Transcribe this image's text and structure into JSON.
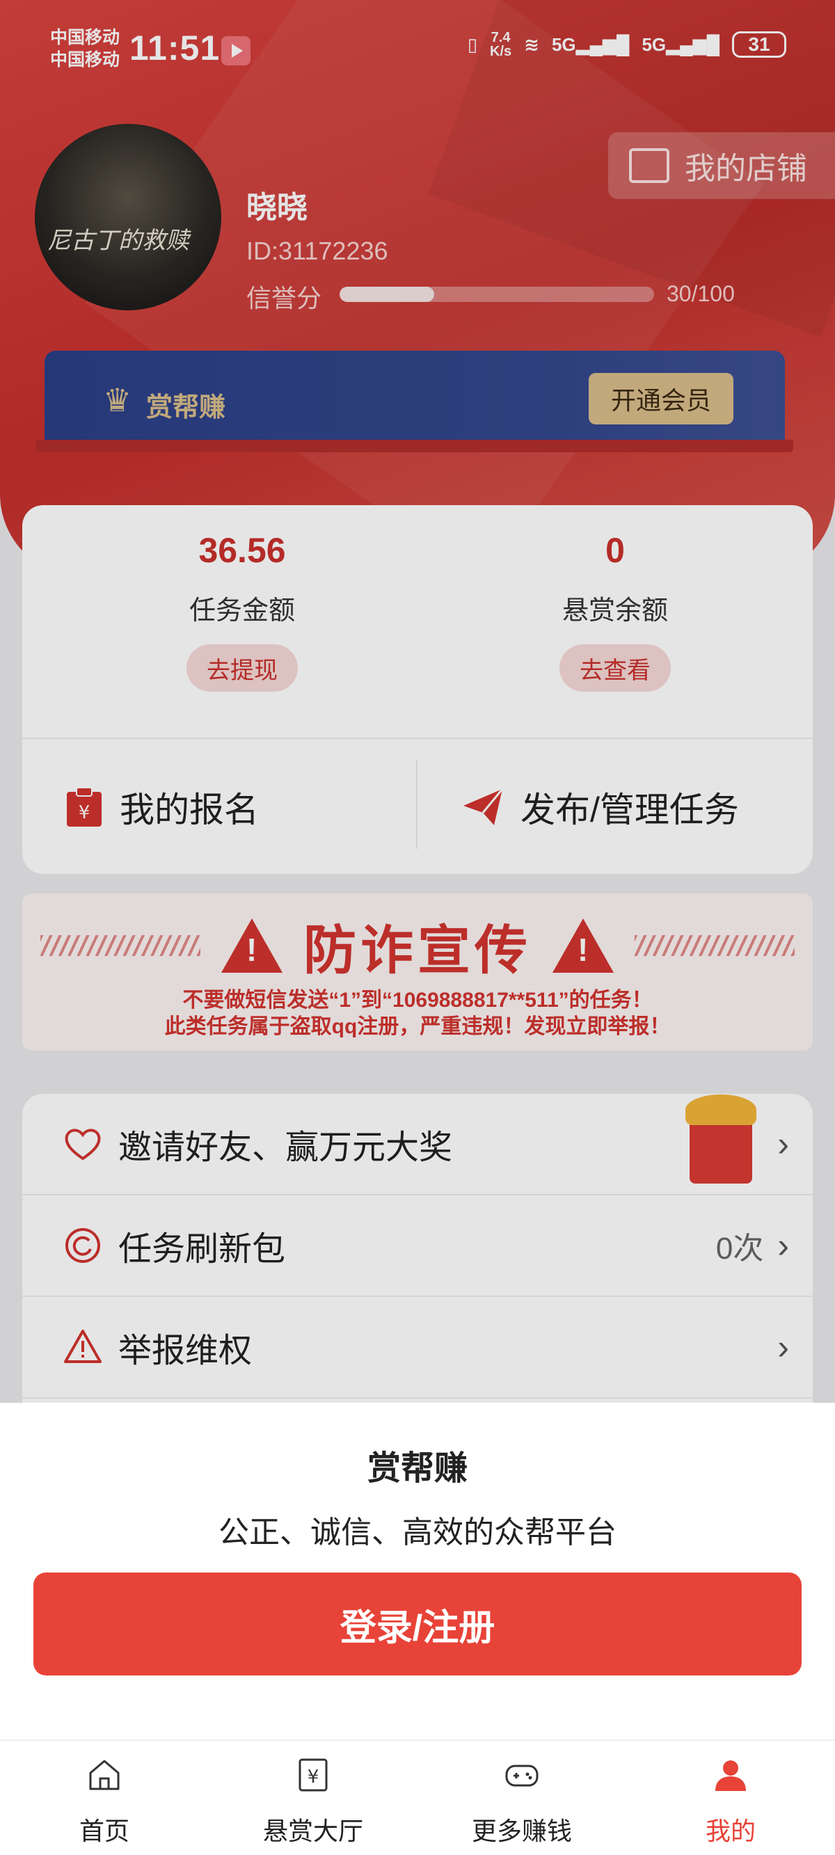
{
  "status_bar": {
    "carrier1": "中国移动",
    "carrier2": "中国移动",
    "time": "11:51",
    "speed_top": "7.4",
    "speed_bottom": "K/s",
    "net1": "5G",
    "net2": "5G",
    "battery": "31"
  },
  "profile": {
    "name": "晓晓",
    "id": "ID:31172236",
    "credit_label": "信誉分",
    "credit_value": "30/100",
    "credit_fraction": 0.3,
    "shop_label": "我的店铺",
    "avatar_text": "尼古丁的救赎"
  },
  "vip": {
    "name": "赏帮赚",
    "button": "开通会员"
  },
  "balances": [
    {
      "amount": "36.56",
      "label": "任务金额",
      "button": "去提现"
    },
    {
      "amount": "0",
      "label": "悬赏余额",
      "button": "去查看"
    }
  ],
  "actions": [
    {
      "label": "我的报名"
    },
    {
      "label": "发布/管理任务"
    }
  ],
  "anti_fraud": {
    "title": "防诈宣传",
    "line1": "不要做短信发送“1”到“1069888817**511”的任务！",
    "line2": "此类任务属于盗取qq注册，严重违规！发现立即举报！"
  },
  "menu": [
    {
      "label": "邀请好友、赢万元大奖",
      "value": ""
    },
    {
      "label": "任务刷新包",
      "value": "0次"
    },
    {
      "label": "举报维权",
      "value": ""
    }
  ],
  "login_sheet": {
    "title": "赏帮赚",
    "subtitle": "公正、诚信、高效的众帮平台",
    "button": "登录/注册"
  },
  "tabs": [
    {
      "label": "首页",
      "icon": "home-icon"
    },
    {
      "label": "悬赏大厅",
      "icon": "yuan-icon"
    },
    {
      "label": "更多赚钱",
      "icon": "gamepad-icon"
    },
    {
      "label": "我的",
      "icon": "person-icon"
    }
  ],
  "colors": {
    "primary": "#e84338",
    "header": "#c9302c",
    "vip_bg": "#2b3f86",
    "gold": "#d7bd8a"
  }
}
